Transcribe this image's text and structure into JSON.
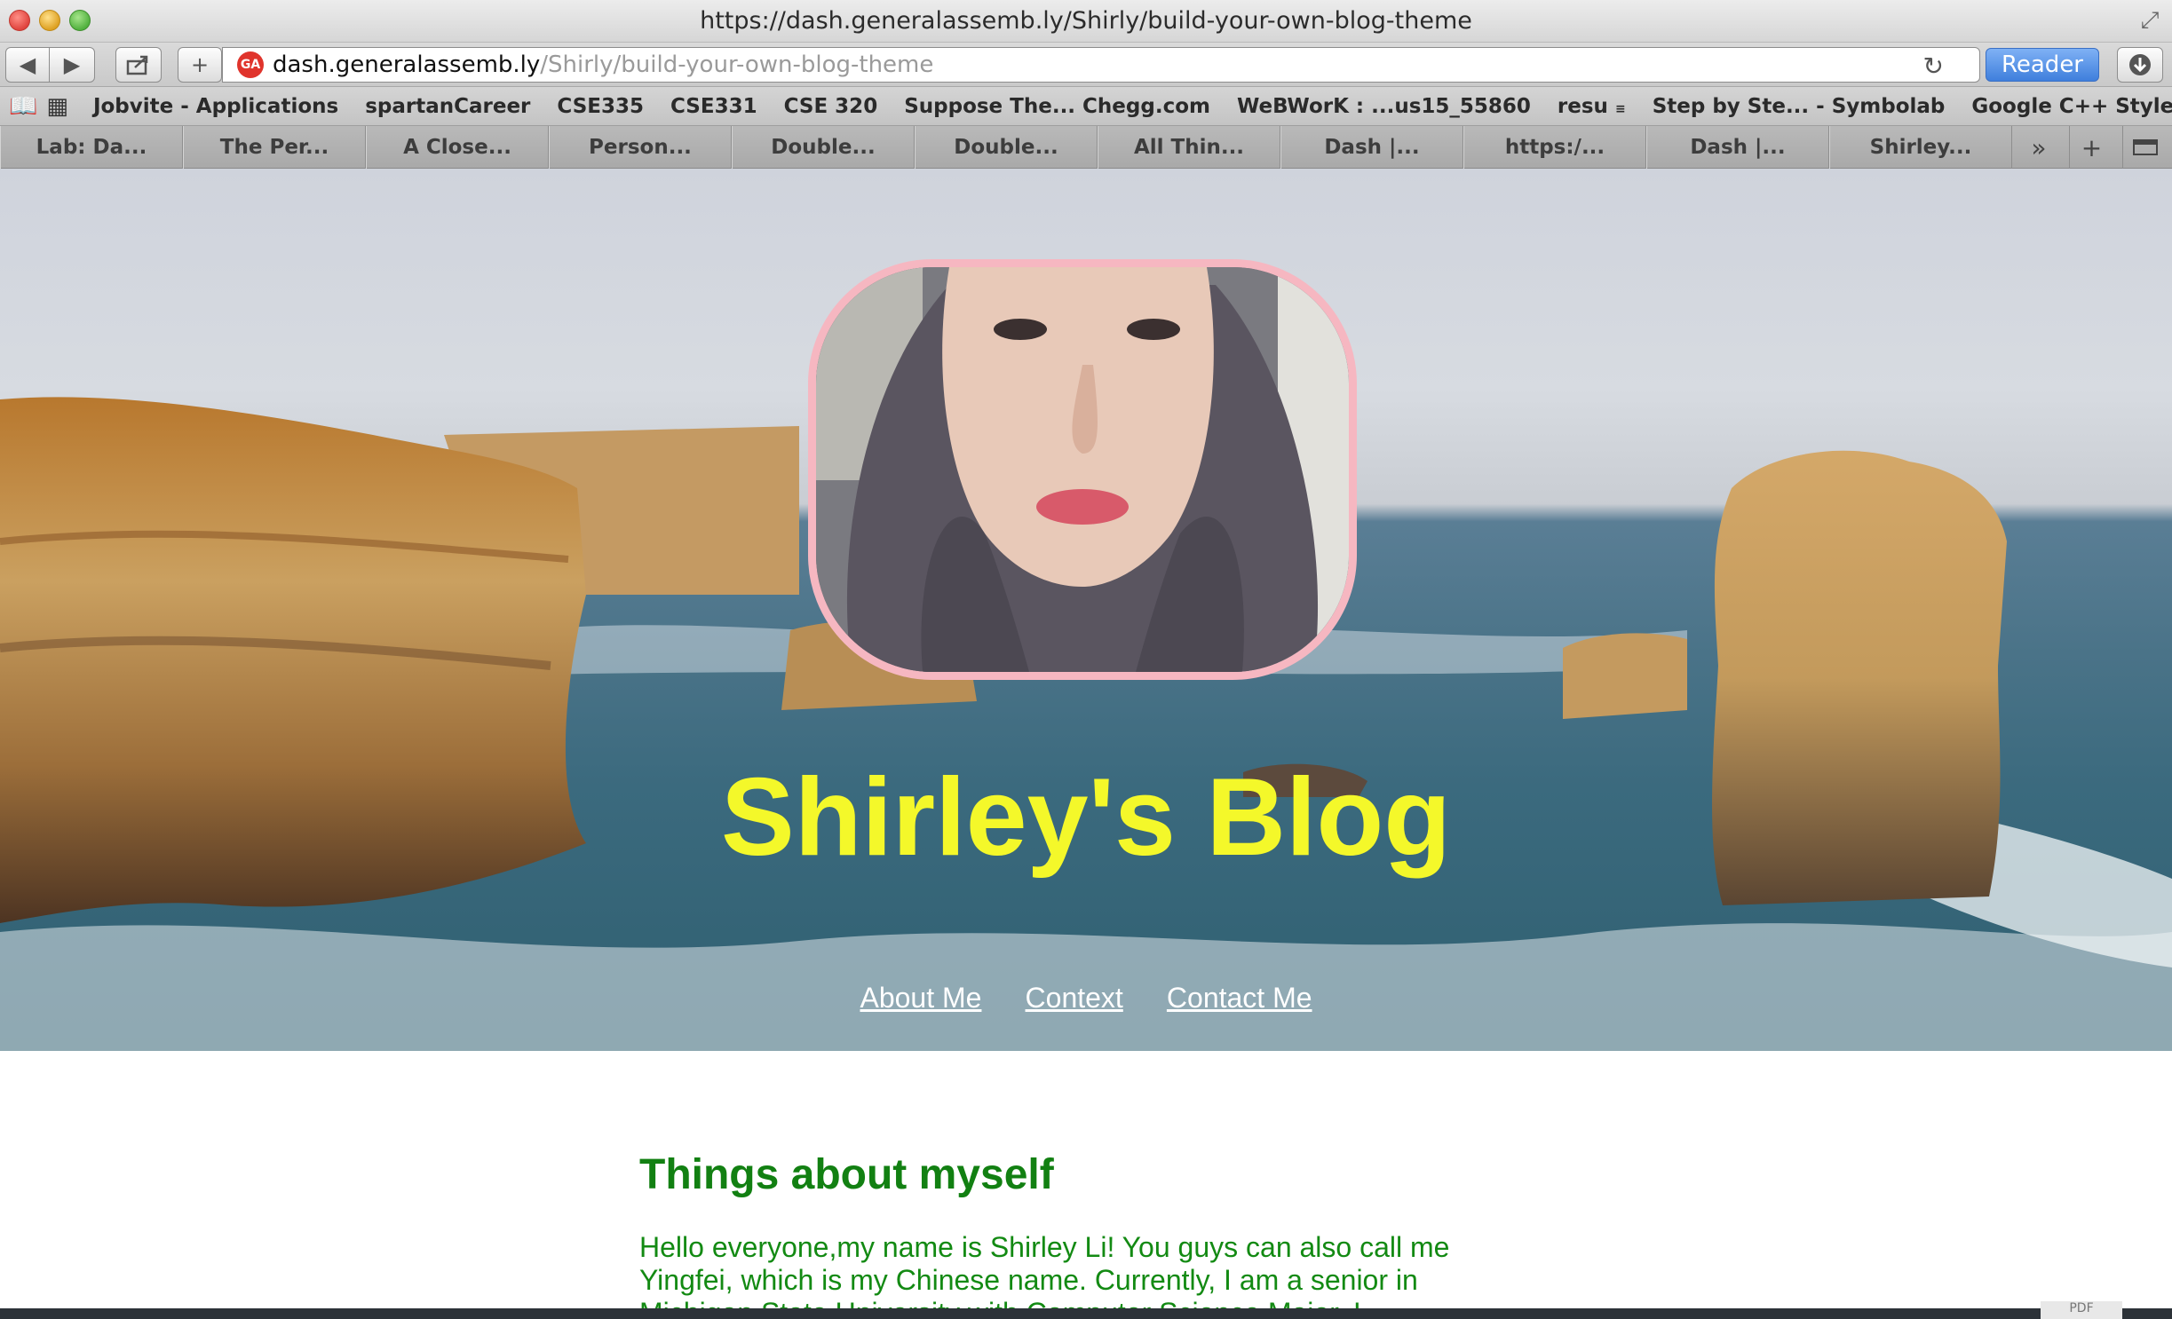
{
  "window": {
    "title": "https://dash.generalassemb.ly/Shirly/build-your-own-blog-theme"
  },
  "toolbar": {
    "url_domain": "dash.generalassemb.ly",
    "url_path": "/Shirly/build-your-own-blog-theme",
    "favicon_text": "GA",
    "reader_label": "Reader"
  },
  "bookmarks": [
    "Jobvite - Applications",
    "spartanCareer",
    "CSE335",
    "CSE331",
    "CSE 320",
    "Suppose The... Chegg.com",
    "WeBWorK : ...us15_55860",
    "resu",
    "Step by Ste... - Symbolab",
    "Google C++ Style Guide"
  ],
  "tabs": [
    "Lab: Da...",
    "The Per...",
    "A Close...",
    "Person...",
    "Double...",
    "Double...",
    "All Thin...",
    "Dash |...",
    "https:/...",
    "Dash |...",
    "Shirley..."
  ],
  "hero": {
    "blog_title": "Shirley's Blog",
    "nav": [
      "About Me",
      "Context",
      "Contact Me"
    ]
  },
  "content": {
    "heading": "Things about myself",
    "paragraph": "Hello everyone,my name is Shirley Li! You guys can also call me Yingfei, which is my Chinese name. Currently, I am a senior in Michigan State University with Computer Science Major. I"
  },
  "colors": {
    "title_yellow": "#f4f82a",
    "avatar_border": "#f6b7c1",
    "heading_green": "#128012",
    "reader_blue": "#3f7fdc"
  },
  "icons": {
    "back": "back-arrow-icon",
    "forward": "forward-arrow-icon",
    "share": "share-icon",
    "add": "plus-icon",
    "reload": "reload-icon",
    "download": "download-icon",
    "bookmarks": "book-icon",
    "top_sites": "grid-icon"
  }
}
